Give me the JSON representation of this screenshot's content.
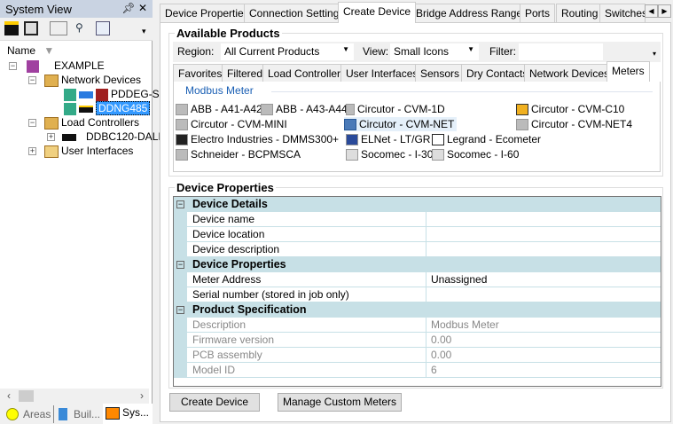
{
  "left_panel": {
    "title": "System View",
    "pin_icon": "pin-icon",
    "close_icon": "close-icon",
    "column_header": "Name",
    "tree": [
      {
        "label": "EXAMPLE",
        "expander": "-"
      },
      {
        "label": "Network Devices",
        "expander": "-"
      },
      {
        "label": "PDDEG-S"
      },
      {
        "label": "DDNG485",
        "selected": true
      },
      {
        "label": "Load Controllers",
        "expander": "-"
      },
      {
        "label": "DDBC120-DALI",
        "expander": "+"
      },
      {
        "label": "User Interfaces",
        "expander": "+"
      }
    ],
    "bottom_tabs": [
      "Areas",
      "Buil...",
      "Sys..."
    ]
  },
  "tabs": [
    "Device Properties",
    "Connection Settings",
    "Create Device",
    "Bridge Address Ranges",
    "Ports",
    "Routing",
    "Switches"
  ],
  "active_tab": "Create Device",
  "available_products": {
    "title": "Available Products",
    "region_label": "Region:",
    "region_value": "All Current Products",
    "view_label": "View:",
    "view_value": "Small Icons",
    "filter_label": "Filter:",
    "filter_value": "",
    "category_tabs": [
      "Favorites",
      "Filtered",
      "Load Controllers",
      "User Interfaces",
      "Sensors",
      "Dry Contacts",
      "Network Devices",
      "Meters"
    ],
    "active_category": "Meters",
    "section": "Modbus Meter",
    "products": [
      "ABB - A41-A42",
      "ABB - A43-A44",
      "Circutor - CVM-1D",
      "Circutor - CVM-C10",
      "Circutor - CVM-MINI",
      "Circutor - CVM-NET",
      "Circutor - CVM-NET4",
      "Electro Industries - DMMS300+",
      "ELNet - LT/GR",
      "Legrand - Ecometer",
      "Schneider - BCPMSCA",
      "Socomec - I-30",
      "Socomec - I-60"
    ],
    "selected_product": "Circutor - CVM-NET"
  },
  "device_properties": {
    "title": "Device Properties",
    "sections": [
      {
        "name": "Device Details",
        "rows": [
          {
            "k": "Device name",
            "v": ""
          },
          {
            "k": "Device location",
            "v": ""
          },
          {
            "k": "Device description",
            "v": ""
          }
        ]
      },
      {
        "name": "Device Properties",
        "rows": [
          {
            "k": "Meter Address",
            "v": "Unassigned"
          },
          {
            "k": "Serial number (stored in job only)",
            "v": ""
          }
        ]
      },
      {
        "name": "Product Specification",
        "readonly": true,
        "rows": [
          {
            "k": "Description",
            "v": "Modbus Meter"
          },
          {
            "k": "Firmware version",
            "v": "0.00"
          },
          {
            "k": "PCB assembly",
            "v": "0.00"
          },
          {
            "k": "Model ID",
            "v": "6"
          }
        ]
      }
    ]
  },
  "buttons": {
    "create": "Create Device",
    "manage": "Manage Custom Meters"
  }
}
